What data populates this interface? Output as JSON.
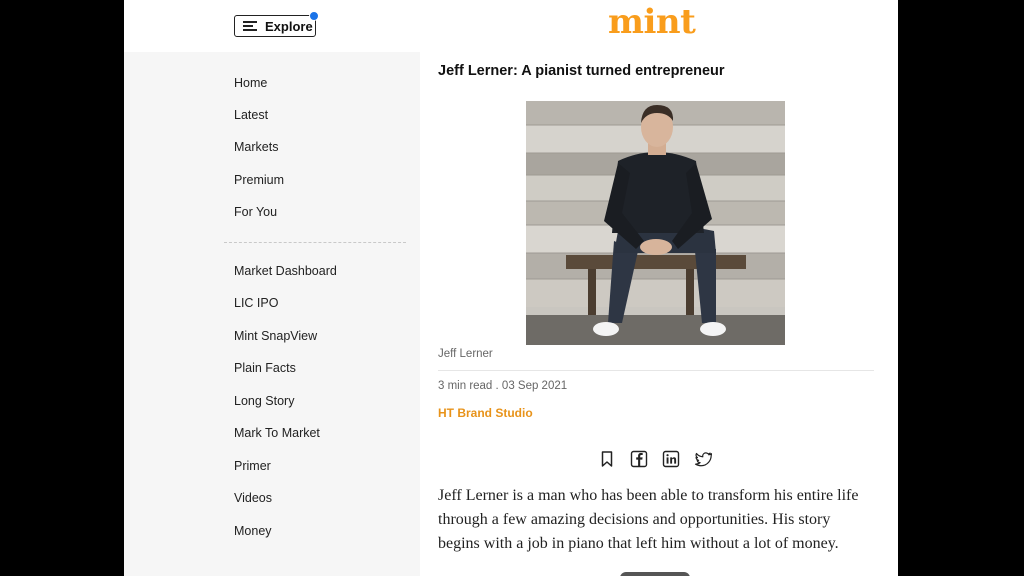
{
  "header": {
    "explore_label": "Explore",
    "logo_text": "mint"
  },
  "sidebar": {
    "items": [
      {
        "label": "Home"
      },
      {
        "label": "Latest"
      },
      {
        "label": "Markets"
      },
      {
        "label": "Premium"
      },
      {
        "label": "For You"
      },
      {
        "label": "Market Dashboard"
      },
      {
        "label": "LIC IPO"
      },
      {
        "label": "Mint SnapView"
      },
      {
        "label": "Plain Facts"
      },
      {
        "label": "Long Story"
      },
      {
        "label": "Mark To Market"
      },
      {
        "label": "Primer"
      },
      {
        "label": "Videos"
      },
      {
        "label": "Money"
      }
    ]
  },
  "article": {
    "title": "Jeff Lerner: A pianist turned entrepreneur",
    "image_caption": "Jeff Lerner",
    "meta": "3 min read . 03 Sep 2021",
    "brand": "HT Brand Studio",
    "share_icons": [
      "bookmark-icon",
      "facebook-icon",
      "linkedin-icon",
      "twitter-icon"
    ],
    "body": "Jeff Lerner is a man who has been able to transform his entire life through a few amazing decisions and opportunities. His story begins with a job in piano that left him without a lot of money."
  },
  "colors": {
    "brand_orange": "#f99d1c",
    "byline_orange": "#e8931a",
    "sidebar_bg": "#f6f6f6",
    "notify_dot": "#1a73e8"
  }
}
